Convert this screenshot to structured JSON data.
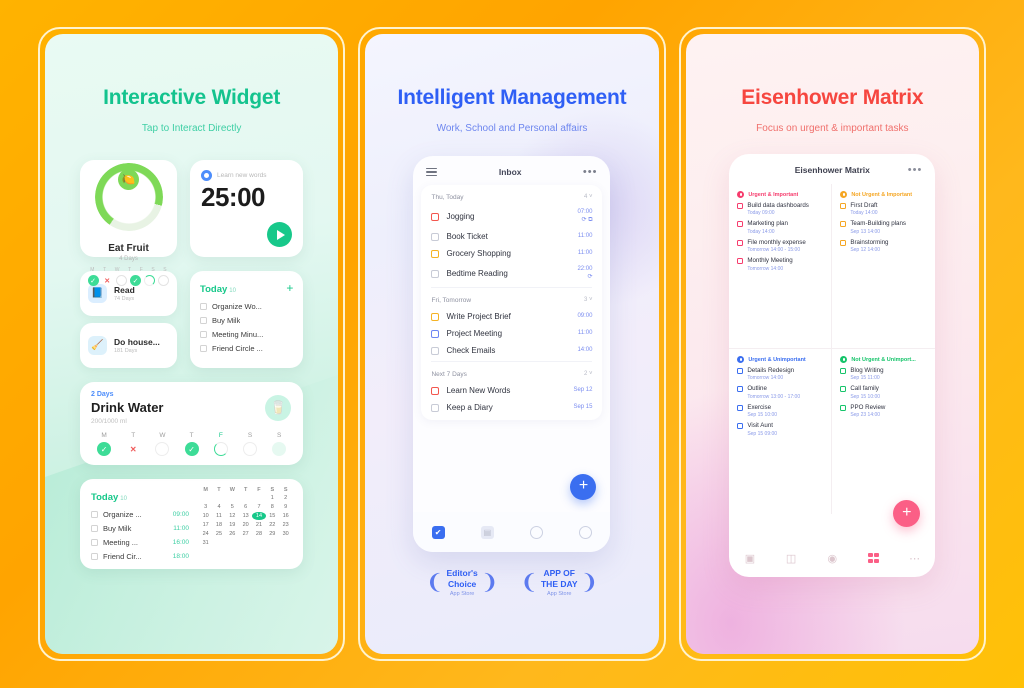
{
  "panels": [
    {
      "title": "Interactive Widget",
      "subtitle": "Tap to Interact Directly",
      "accent": "#14c38e",
      "widgets": {
        "habit_ring": {
          "name": "Eat Fruit",
          "sub": "4 Days",
          "icon": "fruit-icon",
          "weekdays": [
            "M",
            "T",
            "W",
            "T",
            "F",
            "S",
            "S"
          ],
          "states": [
            "done",
            "miss",
            "open",
            "done",
            "part",
            "open",
            "open"
          ]
        },
        "timer": {
          "label": "Learn new words",
          "time": "25:00",
          "play_icon": "play-icon"
        },
        "habits": [
          {
            "name": "Read",
            "days": "74 Days",
            "icon": "book-icon",
            "color": "#e3f0ff"
          },
          {
            "name": "Do house...",
            "days": "181 Days",
            "icon": "broom-icon",
            "color": "#e8f7ff"
          }
        ],
        "today_list": {
          "title": "Today",
          "count": "10",
          "add_icon": "plus-icon",
          "items": [
            "Organize Wo...",
            "Buy Milk",
            "Meeting Minu...",
            "Friend Circle ..."
          ]
        },
        "water": {
          "streak": "2 Days",
          "name": "Drink Water",
          "amount": "200/1000 ml",
          "icon": "water-glass-icon",
          "weekdays": [
            "M",
            "T",
            "W",
            "T",
            "F",
            "S",
            "S"
          ],
          "states": [
            "ok",
            "no",
            "off",
            "ok",
            "hf",
            "off",
            "gh"
          ],
          "highlight_index": 4
        },
        "calendar_card": {
          "title": "Today",
          "count": "10",
          "tasks": [
            {
              "name": "Organize ...",
              "time": "09:00"
            },
            {
              "name": "Buy Milk",
              "time": "11:00"
            },
            {
              "name": "Meeting ...",
              "time": "16:00"
            },
            {
              "name": "Friend Cir...",
              "time": "18:00"
            }
          ],
          "weekday_headers": [
            "M",
            "T",
            "W",
            "T",
            "F",
            "S",
            "S"
          ],
          "days": [
            "",
            "",
            "",
            "",
            "",
            "1",
            "2",
            "3",
            "4",
            "5",
            "6",
            "7",
            "8",
            "9",
            "10",
            "11",
            "12",
            "13",
            "14",
            "15",
            "16",
            "17",
            "18",
            "19",
            "20",
            "21",
            "22",
            "23",
            "24",
            "25",
            "26",
            "27",
            "28",
            "29",
            "30",
            "31"
          ],
          "selected_day": "14"
        }
      }
    },
    {
      "title": "Intelligent Management",
      "subtitle": "Work, School and Personal affairs",
      "accent": "#2f5ff5",
      "phone": {
        "menu_icon": "hamburger-icon",
        "title": "Inbox",
        "more_icon": "more-icon",
        "groups": [
          {
            "label": "Thu, Today",
            "count": "4 ˅",
            "tasks": [
              {
                "name": "Jogging",
                "time": "07:00",
                "sub": "⟳ ⧉",
                "color": "red"
              },
              {
                "name": "Book Ticket",
                "time": "11:00",
                "sub": "",
                "color": ""
              },
              {
                "name": "Grocery Shopping",
                "time": "11:00",
                "sub": "",
                "color": "amber"
              },
              {
                "name": "Bedtime Reading",
                "time": "22:00",
                "sub": "⟳",
                "color": ""
              }
            ]
          },
          {
            "label": "Fri, Tomorrow",
            "count": "3 ˅",
            "tasks": [
              {
                "name": "Write Project Brief",
                "time": "09:00",
                "sub": "",
                "color": "amber"
              },
              {
                "name": "Project Meeting",
                "time": "11:00",
                "sub": "",
                "color": "blue"
              },
              {
                "name": "Check Emails",
                "time": "14:00",
                "sub": "",
                "color": ""
              }
            ]
          },
          {
            "label": "Next 7 Days",
            "count": "2 ˅",
            "tasks": [
              {
                "name": "Learn New Words",
                "time": "Sep 12",
                "sub": "",
                "color": "red"
              },
              {
                "name": "Keep a Diary",
                "time": "Sep 15",
                "sub": "",
                "color": ""
              }
            ]
          }
        ],
        "fab_label": "+",
        "nav": [
          "check-icon",
          "calendar-icon",
          "focus-icon",
          "profile-icon"
        ]
      },
      "awards": [
        {
          "line1": "Editor's",
          "line2": "Choice",
          "store": "App Store"
        },
        {
          "line1": "APP OF",
          "line2": "THE DAY",
          "store": "App Store"
        }
      ]
    },
    {
      "title": "Eisenhower Matrix",
      "subtitle": "Focus on urgent & important tasks",
      "accent": "#f6463f",
      "phone": {
        "title": "Eisenhower Matrix",
        "more_icon": "more-icon",
        "quadrants": [
          {
            "label": "Urgent & Important",
            "color": "#f63c6d",
            "items": [
              {
                "name": "Build data dashboards",
                "time": "Today  09:00"
              },
              {
                "name": "Marketing plan",
                "time": "Today  14:00"
              },
              {
                "name": "File monthly expense",
                "time": "Tomorrow  14:00 - 15:00"
              },
              {
                "name": "Monthly Meeting",
                "time": "Tomorrow 14:00"
              }
            ]
          },
          {
            "label": "Not Urgent & Important",
            "color": "#f5a623",
            "items": [
              {
                "name": "First Draft",
                "time": "Today  14:00"
              },
              {
                "name": "Team-Building plans",
                "time": "Sep 13  14:00"
              },
              {
                "name": "Brainstorming",
                "time": "Sep 12  14:00"
              }
            ]
          },
          {
            "label": "Urgent & Unimportant",
            "color": "#3a6ef0",
            "items": [
              {
                "name": "Details Redesign",
                "time": "Tomorrow  14:00"
              },
              {
                "name": "Outline",
                "time": "Tomorrow  13:00 - 17:00"
              },
              {
                "name": "Exercise",
                "time": "Sep 15  10:00"
              },
              {
                "name": "Visit Aunt",
                "time": "Sep 15  09:00"
              }
            ]
          },
          {
            "label": "Not Urgent & Unimport...",
            "color": "#15c46a",
            "items": [
              {
                "name": "Blog Writing",
                "time": "Sep 15  11:00"
              },
              {
                "name": "Call family",
                "time": "Sep 15  10:00"
              },
              {
                "name": "PPO Review",
                "time": "Sep 23  14:00"
              }
            ]
          }
        ],
        "fab_label": "+",
        "nav": [
          "inbox-icon",
          "board-icon",
          "focus-icon",
          "matrix-icon",
          "more-icon"
        ]
      }
    }
  ]
}
